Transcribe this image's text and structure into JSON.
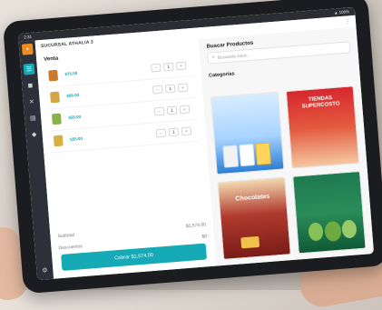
{
  "status_bar": {
    "time": "2:31",
    "right": "▲ 100%"
  },
  "app": {
    "store_title": "SUCURSAL ATHALIA 3"
  },
  "cart": {
    "title": "Venta",
    "items": [
      {
        "price": "$75.00",
        "qty": "1",
        "color": "#c97a2c"
      },
      {
        "price": "$88.00",
        "qty": "1",
        "color": "#d3a546"
      },
      {
        "price": "$58.00",
        "qty": "1",
        "color": "#8bb24a"
      },
      {
        "price": "$55.00",
        "qty": "1",
        "color": "#d7b03f"
      }
    ],
    "subtotal_label": "Subtotal",
    "subtotal_value": "$1,574.00",
    "discount_label": "Descuentos",
    "discount_value": "$0",
    "charge_button": "Cobrar $1,574.00"
  },
  "catalog": {
    "search_title": "Buscar Productos",
    "search_placeholder": "Buscando stock...",
    "categories_title": "Categorías",
    "cards": [
      {
        "label": ""
      },
      {
        "label": "TIENDAS SUPERCOSTO"
      },
      {
        "label": "Chocolates"
      },
      {
        "label": ""
      }
    ]
  },
  "colors": {
    "accent": "#16a9b6",
    "rail": "#2d3038",
    "brand": "#f28b1e"
  },
  "icons": [
    "menu-icon",
    "cart-icon",
    "products-icon",
    "orders-icon",
    "reports-icon",
    "settings-icon",
    "search-icon",
    "more-icon"
  ]
}
